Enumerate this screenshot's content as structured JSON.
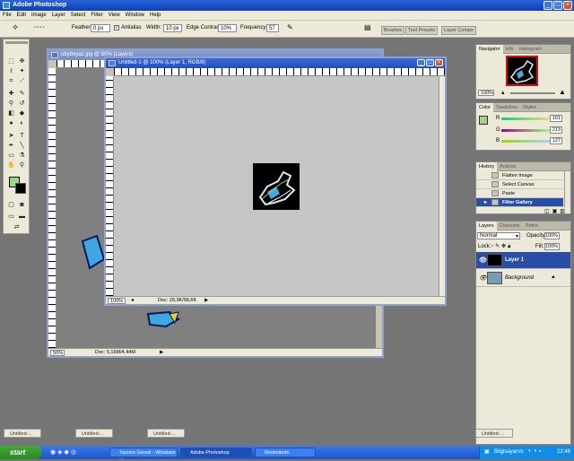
{
  "app": {
    "title": "Adobe Photoshop"
  },
  "menu": [
    "File",
    "Edit",
    "Image",
    "Layer",
    "Select",
    "Filter",
    "View",
    "Window",
    "Help"
  ],
  "options": {
    "feather_label": "Feather:",
    "feather_value": "0 px",
    "antialias_label": "Antialias",
    "width_label": "Width:",
    "width_value": "10 px",
    "edge_contrast_label": "Edge Contrast:",
    "edge_contrast_value": "10%",
    "frequency_label": "Frequency:",
    "frequency_value": "57",
    "well_tabs": [
      "Brushes",
      "Tool Presets",
      "Layer Comps"
    ]
  },
  "doc_back": {
    "title": "ubyboyaz.jpg @ 50% (Layers)",
    "zoom": "50%",
    "doc_info": "Doc: 5,16M/4,44M"
  },
  "doc_front": {
    "title": "Untitled-1 @ 100% (Layer 1, RGB/8)",
    "zoom": "100%",
    "doc_info": "Doc: 29,3K/58,6K"
  },
  "navigator": {
    "tabs": [
      "Navigator",
      "Info",
      "Histogram"
    ],
    "zoom": "100%"
  },
  "color": {
    "tabs": [
      "Color",
      "Swatches",
      "Styles"
    ],
    "channels": [
      {
        "label": "R",
        "value": "161"
      },
      {
        "label": "G",
        "value": "213"
      },
      {
        "label": "B",
        "value": "127"
      }
    ],
    "foreground": "#a1d57f"
  },
  "history": {
    "tabs": [
      "History",
      "Actions"
    ],
    "items": [
      "Flatten Image",
      "Select Canvas",
      "Paste",
      "Filter Gallery"
    ]
  },
  "layers": {
    "tabs": [
      "Layers",
      "Channels",
      "Paths"
    ],
    "blend_mode": "Normal",
    "opacity_label": "Opacity:",
    "opacity_value": "100%",
    "lock_label": "Lock:",
    "fill_label": "Fill:",
    "fill_value": "100%",
    "items": [
      {
        "name": "Layer 1",
        "selected": true
      },
      {
        "name": "Background",
        "selected": false
      }
    ]
  },
  "minimized_docs": [
    "Untitled-...",
    "Untitled-...",
    "Untitled-...",
    "Untitled-..."
  ],
  "taskbar": {
    "start": "start",
    "items": [
      "Yazılım Geneli - Windows ...",
      "Adobe Photoshop",
      "Resimlerim"
    ],
    "tray_label": "Bilgisayarım",
    "clock": "22:48"
  }
}
